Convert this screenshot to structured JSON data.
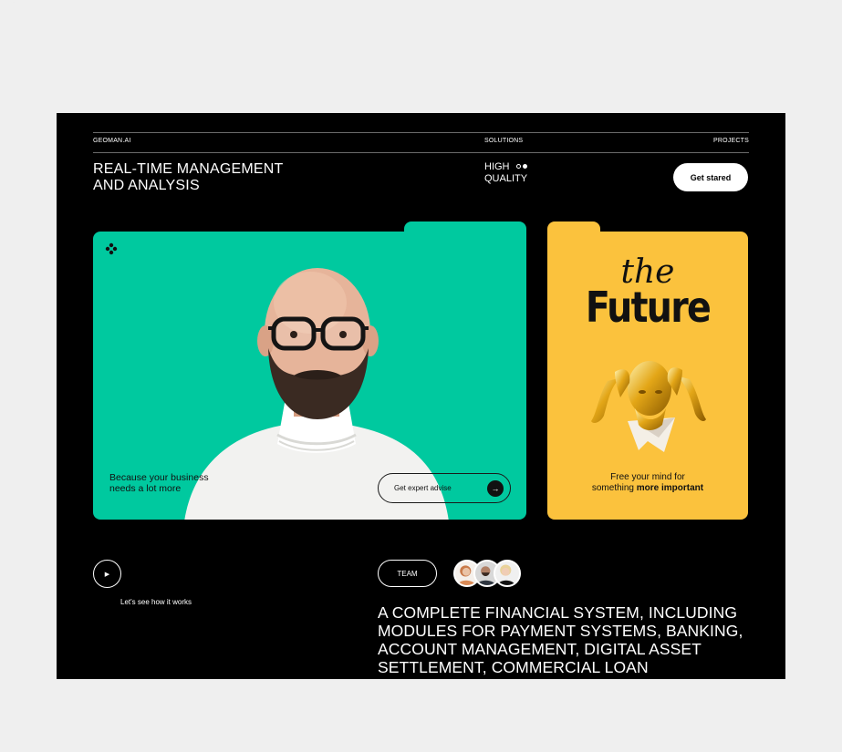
{
  "header": {
    "brand": "GEOMAN.AI",
    "nav": {
      "solutions": "SOLUTIONS",
      "projects": "PROJECTS"
    }
  },
  "hero": {
    "headline": "REAL-TIME MANAGEMENT AND ANALYSIS",
    "quality": "HIGH QUALITY",
    "cta_label": "Get stared"
  },
  "green_card": {
    "tagline": "Because your business needs a lot more",
    "button_label": "Get expert advise",
    "accent": "#00c99f"
  },
  "yellow_card": {
    "the": "the",
    "future": "Future",
    "caption_line1": "Free your mind for",
    "caption_line2": "something",
    "caption_bold": "more important",
    "accent": "#fbc23d"
  },
  "bottom": {
    "how_label": "Let's see how it works",
    "team_label": "TEAM",
    "statement": "A COMPLETE FINANCIAL SYSTEM, INCLUDING MODULES FOR PAYMENT SYSTEMS, BANKING, ACCOUNT MANAGEMENT, DIGITAL ASSET SETTLEMENT, COMMERCIAL LOAN PROCESSING,"
  },
  "icons": [
    "brand-dots-icon",
    "arrow-right-icon",
    "play-icon"
  ]
}
